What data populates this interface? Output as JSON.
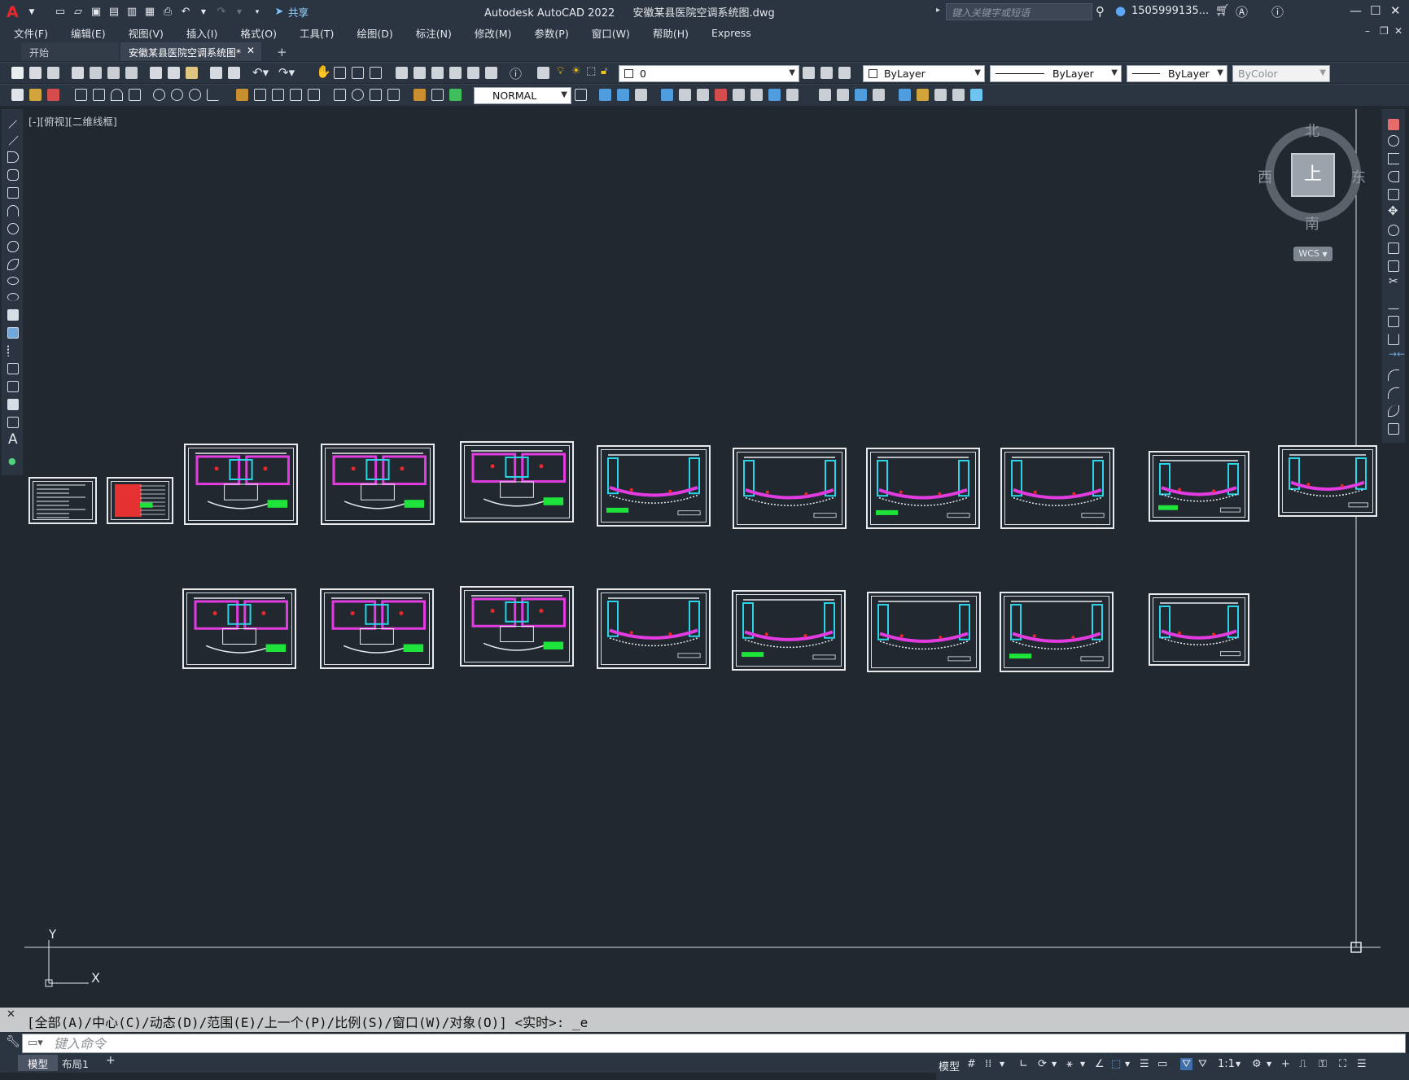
{
  "titlebar": {
    "app_title": "Autodesk AutoCAD 2022",
    "file_name": "安徽某县医院空调系统图.dwg",
    "share_label": "共享",
    "search_placeholder": "键入关键字或短语",
    "user_name": "1505999135..."
  },
  "menu": {
    "items": [
      "文件(F)",
      "编辑(E)",
      "视图(V)",
      "插入(I)",
      "格式(O)",
      "工具(T)",
      "绘图(D)",
      "标注(N)",
      "修改(M)",
      "参数(P)",
      "窗口(W)",
      "帮助(H)",
      "Express"
    ]
  },
  "tabs": {
    "start": "开始",
    "drawing": "安徽某县医院空调系统图*",
    "new_tab": "+"
  },
  "properties": {
    "layer": "0",
    "color": "ByLayer",
    "linetype": "ByLayer",
    "lineweight": "ByLayer",
    "plotstyle": "ByColor",
    "dimstyle": "NORMAL"
  },
  "viewport": {
    "label": "[-][俯视][二维线框]",
    "axis_y": "Y",
    "axis_x": "X"
  },
  "viewcube": {
    "north": "北",
    "south": "南",
    "east": "东",
    "west": "西",
    "face": "上",
    "wcs": "WCS"
  },
  "command": {
    "history": "[全部(A)/中心(C)/动态(D)/范围(E)/上一个(P)/比例(S)/窗口(W)/对象(O)] <实时>: _e",
    "placeholder": "键入命令"
  },
  "layout_tabs": {
    "model": "模型",
    "layout1": "布局1",
    "add": "+"
  },
  "status": {
    "model": "模型",
    "scale": "1:1"
  },
  "colors": {
    "background": "#212830",
    "ui_panel": "#2b3441",
    "sheet_line": "#e8eaee",
    "accent_red": "#e8282c",
    "plan_cyan": "#2ad4e6",
    "plan_magenta": "#e23ce0",
    "plan_green": "#1ee33a"
  }
}
